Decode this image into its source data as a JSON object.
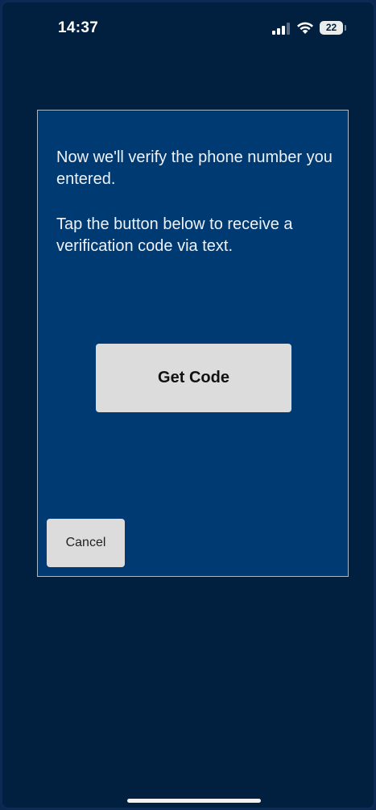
{
  "status_bar": {
    "time": "14:37",
    "battery_level": "22",
    "battery_fraction": 0.22,
    "icons": [
      "signal-icon",
      "wifi-icon",
      "battery-icon"
    ]
  },
  "dialog": {
    "message_line_1": "Now we'll verify the phone number you entered.",
    "message_line_2": "Tap the button below to receive a verification code via text.",
    "get_code_label": "Get Code",
    "cancel_label": "Cancel"
  },
  "colors": {
    "background": "#01203f",
    "dialog_background": "#003a72",
    "dialog_border": "#a9b9cc",
    "button_background": "#dcdcdc",
    "text": "#eef2f7"
  }
}
